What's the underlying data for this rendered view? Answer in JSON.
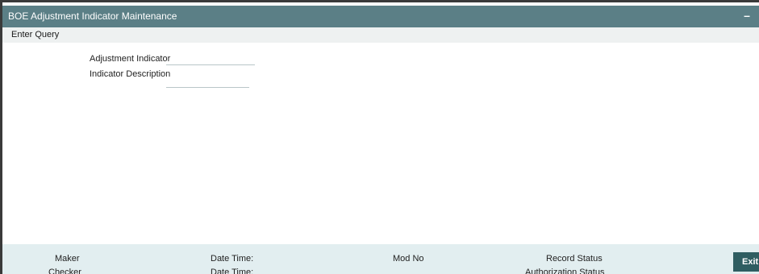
{
  "window": {
    "title": "BOE Adjustment Indicator Maintenance",
    "minimize_label": "–"
  },
  "menu": {
    "enter_query": "Enter Query"
  },
  "form": {
    "adjustment_indicator_label": "Adjustment Indicator",
    "adjustment_indicator_value": "",
    "indicator_description_label": "Indicator Description",
    "indicator_description_value": ""
  },
  "footer": {
    "maker_label": "Maker",
    "checker_label": "Checker",
    "maker_date_time_label": "Date Time:",
    "checker_date_time_label": "Date Time:",
    "mod_no_label": "Mod No",
    "record_status_label": "Record Status",
    "authorization_status_label": "Authorization Status",
    "exit_label": "Exit"
  },
  "colors": {
    "title_bar": "#5b7f86",
    "menu_bar": "#eef1f1",
    "footer": "#e2eef0",
    "exit_button": "#2f5d61"
  }
}
